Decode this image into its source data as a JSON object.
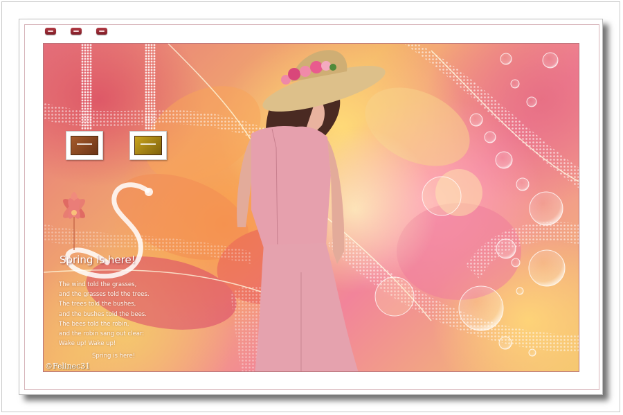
{
  "window": {
    "buttons": [
      "minimize",
      "minimize",
      "minimize"
    ],
    "button_color": "#9c2a34"
  },
  "artwork": {
    "headline": "Spring is here!",
    "poem_lines": [
      "The wind told the grasses,",
      "and the grasses told the trees.",
      "The trees told the bushes,",
      "and the bushes told the bees.",
      "The bees told the robin,",
      "and the robin sang out clear:",
      "Wake up! Wake up!"
    ],
    "poem_end": "Spring is here!",
    "signature": "©Felinec31",
    "decorative_letter": "S"
  },
  "swatches": [
    {
      "name": "copper",
      "color": "#8a4a22"
    },
    {
      "name": "gold",
      "color": "#a88412"
    }
  ],
  "palette": {
    "pink": "#f2849a",
    "gold": "#f3c56e",
    "coral": "#e5737e",
    "dress": "#e9a9b4"
  }
}
